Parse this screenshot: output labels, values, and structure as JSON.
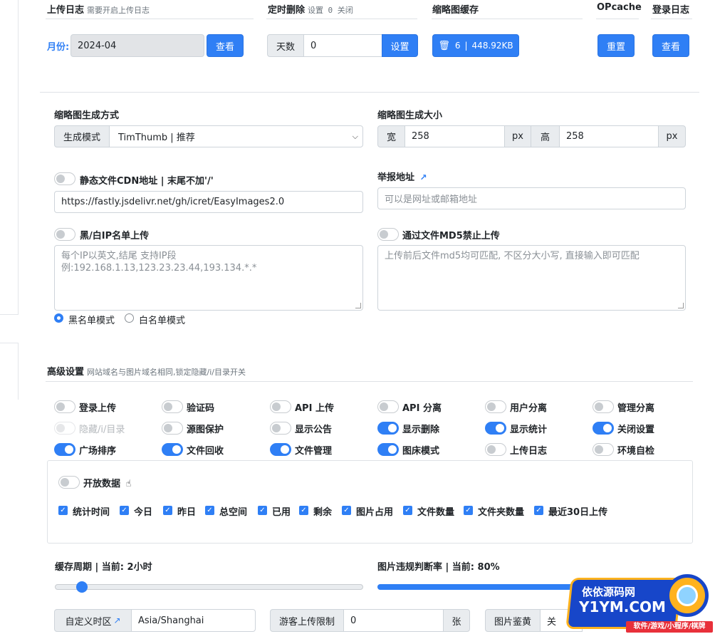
{
  "top": {
    "upload_log": {
      "title": "上传日志",
      "hint": "需要开启上传日志",
      "month_label": "月份:",
      "month_value": "2024-04",
      "view_btn": "查看"
    },
    "auto_delete": {
      "title": "定时删除",
      "hint_pre": "设置",
      "hint_val": "0",
      "hint_post": "关闭",
      "days_label": "天数",
      "days_value": "0",
      "set_btn": "设置"
    },
    "thumb_cache": {
      "title": "缩略图缓存",
      "count": "6",
      "size": "448.92KB"
    },
    "opcache": {
      "title": "OPcache",
      "reset_btn": "重置"
    },
    "login_log": {
      "title": "登录日志",
      "view_btn": "查看"
    }
  },
  "thumb": {
    "method_title": "缩略图生成方式",
    "mode_label": "生成模式",
    "mode_value": "TimThumb | 推荐",
    "size_title": "缩略图生成大小",
    "width_label": "宽",
    "width_value": "258",
    "unit": "px",
    "height_label": "高",
    "height_value": "258"
  },
  "cdn": {
    "label": "静态文件CDN地址 | 末尾不加'/'",
    "value": "https://fastly.jsdelivr.net/gh/icret/EasyImages2.0",
    "on": false
  },
  "report": {
    "label": "举报地址",
    "placeholder": "可以是网址或邮箱地址"
  },
  "ip_list": {
    "label": "黑/白IP名单上传",
    "placeholder": "每个IP以英文,结尾 支持IP段 例:192.168.1.13,123.23.23.44,193.134.*.*",
    "black_label": "黑名单模式",
    "white_label": "白名单模式",
    "selected": "black"
  },
  "md5": {
    "label": "通过文件MD5禁止上传",
    "placeholder": "上传前后文件md5均可匹配, 不区分大小写, 直接输入即可匹配"
  },
  "advanced": {
    "title": "高级设置",
    "hint": "网站域名与图片域名相同,锁定隐藏/i/目录开关",
    "toggles": [
      {
        "label": "登录上传",
        "on": false,
        "disabled": false
      },
      {
        "label": "验证码",
        "on": false,
        "disabled": false
      },
      {
        "label": "API 上传",
        "on": false,
        "disabled": false
      },
      {
        "label": "API 分离",
        "on": false,
        "disabled": false
      },
      {
        "label": "用户分离",
        "on": false,
        "disabled": false
      },
      {
        "label": "管理分离",
        "on": false,
        "disabled": false
      },
      {
        "label": "隐藏/i/目录",
        "on": false,
        "disabled": true
      },
      {
        "label": "源图保护",
        "on": false,
        "disabled": false
      },
      {
        "label": "显示公告",
        "on": false,
        "disabled": false
      },
      {
        "label": "显示删除",
        "on": true,
        "disabled": false
      },
      {
        "label": "显示统计",
        "on": true,
        "disabled": false
      },
      {
        "label": "关闭设置",
        "on": true,
        "disabled": false
      },
      {
        "label": "广场排序",
        "on": true,
        "disabled": false
      },
      {
        "label": "文件回收",
        "on": true,
        "disabled": false
      },
      {
        "label": "文件管理",
        "on": true,
        "disabled": false
      },
      {
        "label": "图床模式",
        "on": true,
        "disabled": false
      },
      {
        "label": "上传日志",
        "on": false,
        "disabled": false
      },
      {
        "label": "环境自检",
        "on": false,
        "disabled": false
      }
    ]
  },
  "open_data": {
    "label": "开放数据",
    "checks": [
      "统计时间",
      "今日",
      "昨日",
      "总空间",
      "已用",
      "剩余",
      "图片占用",
      "文件数量",
      "文件夹数量",
      "最近30日上传"
    ]
  },
  "cache": {
    "label": "缓存周期 | 当前: 2小时",
    "fraction": 0.07
  },
  "violation": {
    "label": "图片违规判断率 | 当前: 80%",
    "fraction": 0.8
  },
  "bottom": {
    "timezone_label": "自定义时区",
    "timezone_value": "Asia/Shanghai",
    "guest_label": "游客上传限制",
    "guest_value": "0",
    "guest_unit": "张",
    "nsfw_label": "图片鉴黄",
    "nsfw_value": "关"
  },
  "watermark": {
    "site": "依依源码网",
    "domain": "Y1YM.COM",
    "tagline": "软件/游戏/小程序/棋牌"
  },
  "colors": {
    "accent": "#2f7ff5",
    "link": "#2f7ff5"
  }
}
